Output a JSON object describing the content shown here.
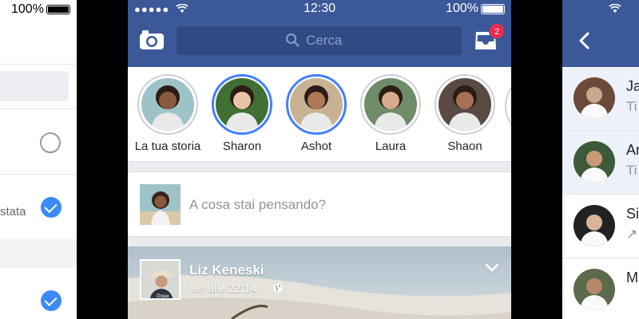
{
  "left_phone": {
    "battery_pct": "100%",
    "status_fragment": "stata"
  },
  "center_phone": {
    "status": {
      "time": "12:30",
      "battery_pct": "100%"
    },
    "header": {
      "search_placeholder": "Cerca",
      "notification_count": "2"
    },
    "stories": [
      {
        "label": "La tua storia",
        "active": false,
        "avatar": "person-woman-curly",
        "skin": "#8a5a3c",
        "bg": "#9dc3c9"
      },
      {
        "label": "Sharon",
        "active": true,
        "avatar": "person-woman-smiling",
        "skin": "#e8c4a8",
        "bg": "#3f6f34"
      },
      {
        "label": "Ashot",
        "active": true,
        "avatar": "person-man-outdoors",
        "skin": "#b07858",
        "bg": "#c7b294"
      },
      {
        "label": "Laura",
        "active": false,
        "avatar": "person-woman-brunette",
        "skin": "#d8a98a",
        "bg": "#6f8c6a"
      },
      {
        "label": "Shaon",
        "active": false,
        "avatar": "person-man-glasses",
        "skin": "#a67155",
        "bg": "#5a4a44"
      }
    ],
    "composer": {
      "placeholder": "A cosa stai pensando?"
    },
    "post": {
      "author": "Liz Keneski",
      "timestamp": "Ieri alle 22:14"
    },
    "colors": {
      "brand_blue": "#3b5998",
      "story_ring_active": "#4080ff",
      "badge_red": "#f02849"
    }
  },
  "right_phone": {
    "rows": [
      {
        "name": "Ja",
        "sub": "Ti",
        "highlighted": true
      },
      {
        "name": "An",
        "sub": "Ti",
        "highlighted": true
      },
      {
        "name": "Si",
        "sub": "↗",
        "highlighted": false
      },
      {
        "name": "M",
        "sub": "",
        "highlighted": false
      }
    ]
  }
}
